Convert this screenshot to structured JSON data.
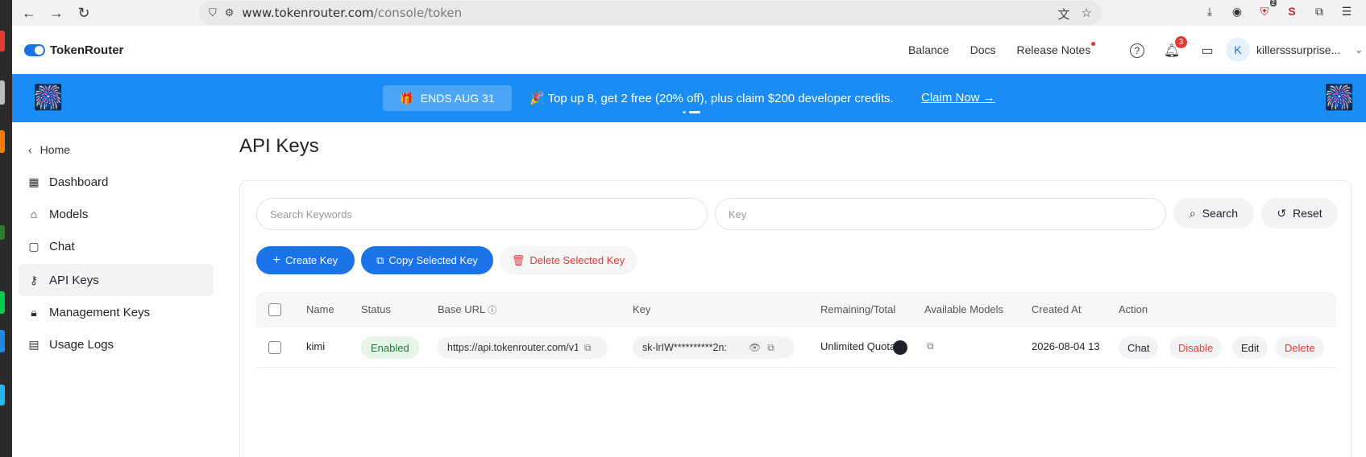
{
  "browser": {
    "url_host": "www.tokenrouter.com",
    "url_path": "/console/token",
    "ext_badge": "2"
  },
  "header": {
    "brand": "TokenRouter",
    "nav": [
      "Balance",
      "Docs",
      "Release Notes"
    ],
    "notif_count": "3",
    "avatar_letter": "K",
    "username": "killersssurprise..."
  },
  "banner": {
    "ends": "ENDS AUG 31",
    "promo": "🎉 Top up 8, get 2 free (20% off), plus claim $200 developer credits.",
    "claim": "Claim Now"
  },
  "sidebar": {
    "home": "Home",
    "items": [
      "Dashboard",
      "Models",
      "Chat",
      "API Keys",
      "Management Keys",
      "Usage Logs"
    ],
    "active": "API Keys"
  },
  "main": {
    "title": "API Keys",
    "search_placeholder": "Search Keywords",
    "key_placeholder": "Key",
    "search_label": "Search",
    "reset_label": "Reset",
    "create_label": "Create Key",
    "copy_label": "Copy Selected Key",
    "delete_label": "Delete Selected Key"
  },
  "table": {
    "headers": [
      "Name",
      "Status",
      "Base URL",
      "Key",
      "Remaining/Total",
      "Available Models",
      "Created At",
      "Action"
    ],
    "rows": [
      {
        "name": "kimi",
        "status": "Enabled",
        "base_url": "https://api.tokenrouter.com/v1",
        "key": "sk-lrIW**********2n:",
        "remaining": "Unlimited Quota",
        "created": "2026-08-04 13",
        "actions": [
          "Chat",
          "Disable",
          "Edit",
          "Delete"
        ]
      }
    ]
  },
  "colors": {
    "accent": "#1a73e8",
    "banner": "#1a8cf5",
    "danger": "#e53935",
    "success": "#1e7e34"
  }
}
